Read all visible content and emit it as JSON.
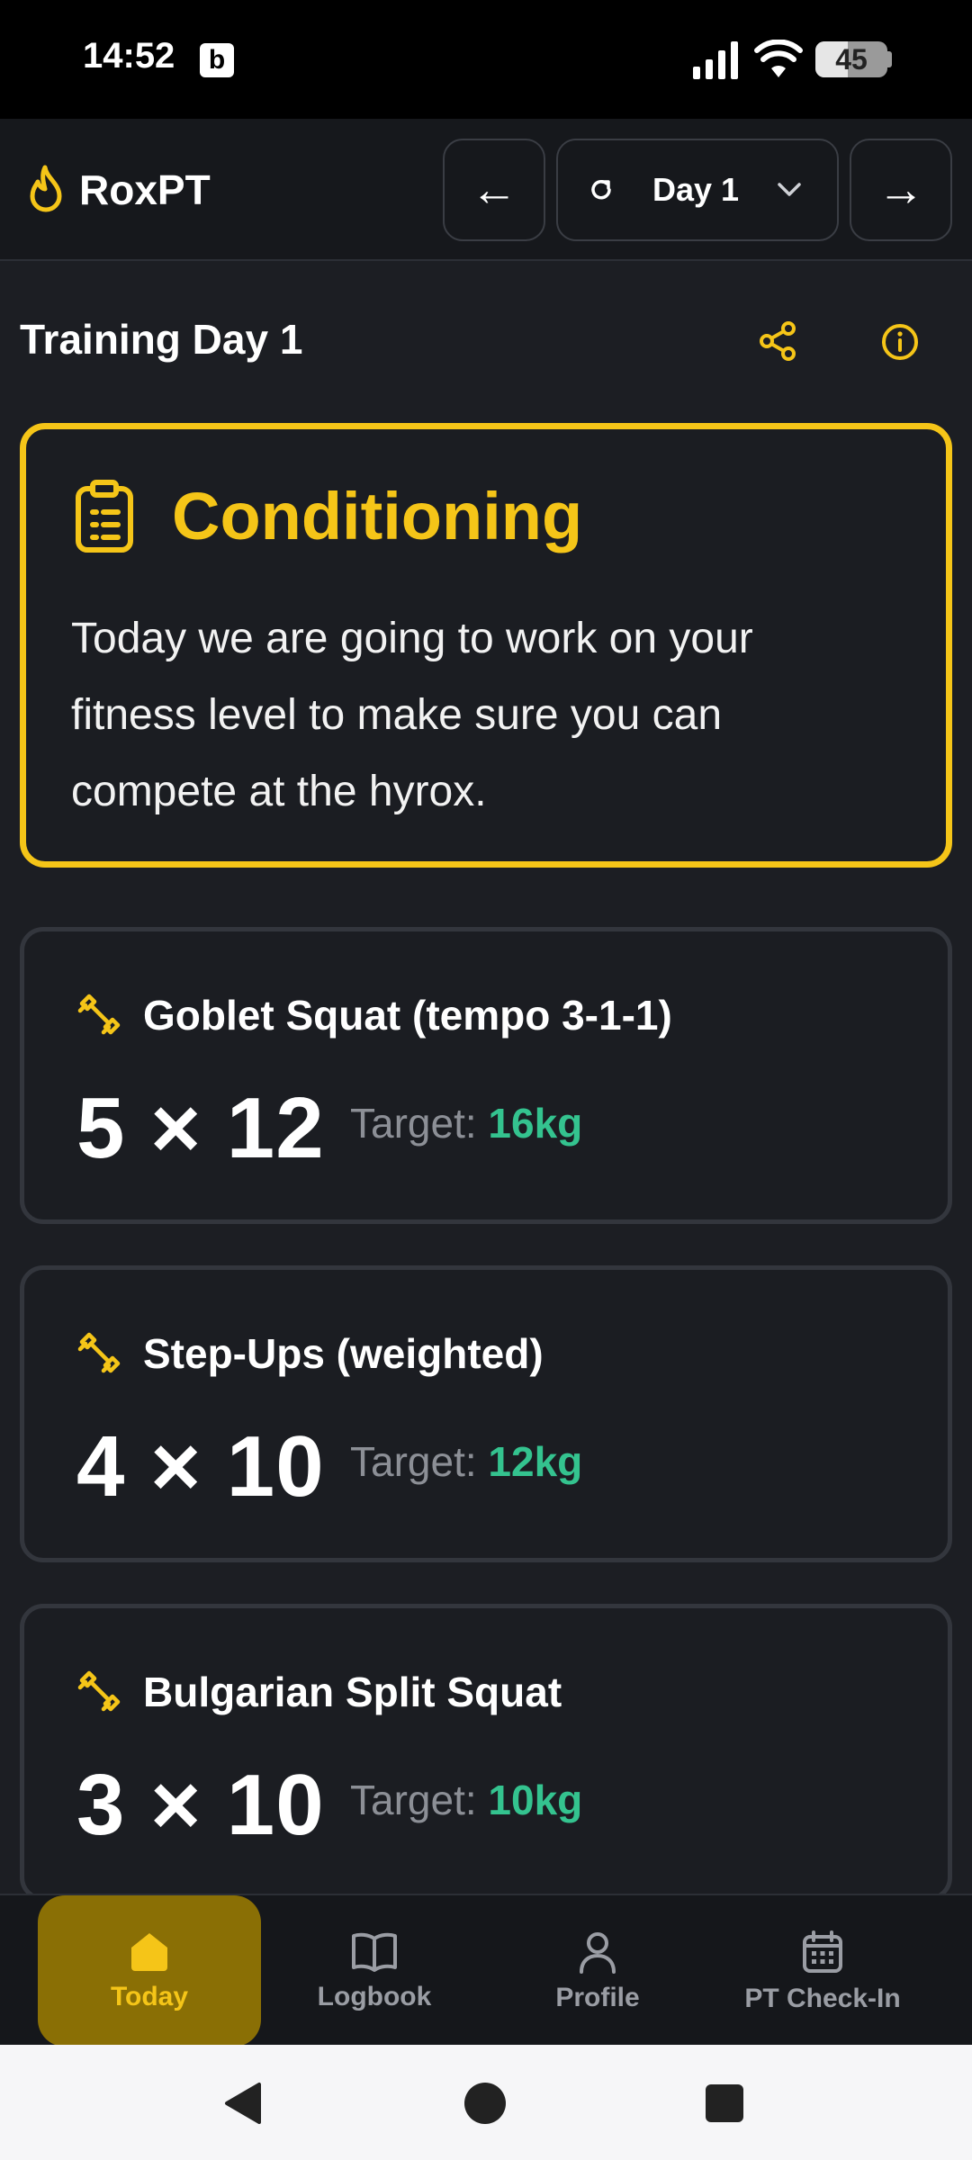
{
  "status_bar": {
    "time": "14:52",
    "notification_badge": "b",
    "battery_percent": 45,
    "battery_label": "45"
  },
  "header": {
    "app_name": "RoxPT",
    "prev_label": "←",
    "next_label": "→",
    "day_selector": "Day 1"
  },
  "main": {
    "title": "Training Day 1",
    "focus": {
      "title": "Conditioning",
      "description": "Today we are going to work on your fitness level to make sure you can compete at the hyrox."
    },
    "exercises": [
      {
        "name": "Goblet Squat (tempo 3-1-1)",
        "sets_reps": "5 × 12",
        "target_label": "Target:",
        "target_weight": "16kg"
      },
      {
        "name": "Step-Ups (weighted)",
        "sets_reps": "4 × 10",
        "target_label": "Target:",
        "target_weight": "12kg"
      },
      {
        "name": "Bulgarian Split Squat",
        "sets_reps": "3 × 10",
        "target_label": "Target:",
        "target_weight": "10kg"
      }
    ]
  },
  "bottom_nav": {
    "items": [
      {
        "label": "Today",
        "icon": "home-icon",
        "active": true
      },
      {
        "label": "Logbook",
        "icon": "book-icon",
        "active": false
      },
      {
        "label": "Profile",
        "icon": "user-icon",
        "active": false
      },
      {
        "label": "PT Check-In",
        "icon": "calendar-icon",
        "active": false
      }
    ]
  },
  "colors": {
    "accent": "#f5c518",
    "success": "#34c38f",
    "background": "#1c1e23",
    "card": "#1b1d22"
  }
}
